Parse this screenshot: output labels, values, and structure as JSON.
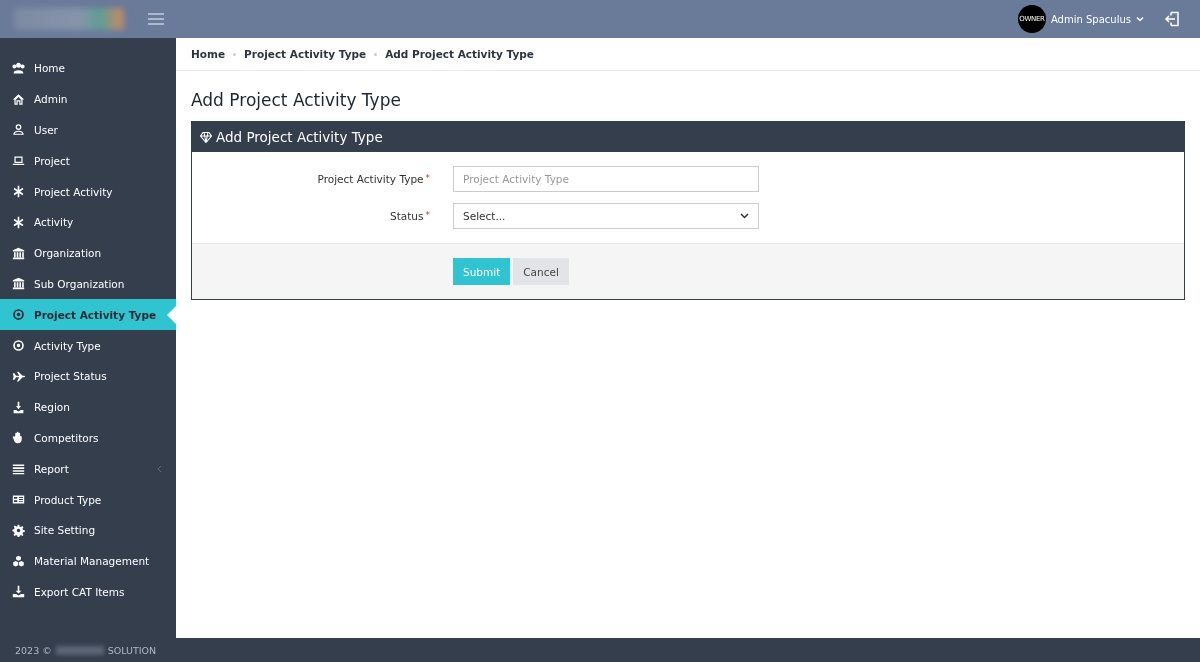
{
  "topbar": {
    "user": {
      "avatar_text": "OWNER",
      "name": "Admin Spaculus"
    }
  },
  "sidebar": {
    "items": [
      {
        "label": "Home",
        "selected": false,
        "expandable": false
      },
      {
        "label": "Admin",
        "selected": false,
        "expandable": false
      },
      {
        "label": "User",
        "selected": false,
        "expandable": false
      },
      {
        "label": "Project",
        "selected": false,
        "expandable": false
      },
      {
        "label": "Project Activity",
        "selected": false,
        "expandable": false
      },
      {
        "label": "Activity",
        "selected": false,
        "expandable": false
      },
      {
        "label": "Organization",
        "selected": false,
        "expandable": false
      },
      {
        "label": "Sub Organization",
        "selected": false,
        "expandable": false
      },
      {
        "label": "Project Activity Type",
        "selected": true,
        "expandable": false
      },
      {
        "label": "Activity Type",
        "selected": false,
        "expandable": false
      },
      {
        "label": "Project Status",
        "selected": false,
        "expandable": false
      },
      {
        "label": "Region",
        "selected": false,
        "expandable": false
      },
      {
        "label": "Competitors",
        "selected": false,
        "expandable": false
      },
      {
        "label": "Report",
        "selected": false,
        "expandable": true
      },
      {
        "label": "Product Type",
        "selected": false,
        "expandable": false
      },
      {
        "label": "Site Setting",
        "selected": false,
        "expandable": false
      },
      {
        "label": "Material Management",
        "selected": false,
        "expandable": false
      },
      {
        "label": "Export CAT Items",
        "selected": false,
        "expandable": false
      }
    ]
  },
  "breadcrumb": [
    "Home",
    "Project Activity Type",
    "Add Project Activity Type"
  ],
  "page_title": "Add Project Activity Type",
  "panel": {
    "title": "Add Project Activity Type",
    "fields": [
      {
        "kind": "text",
        "label": "Project Activity Type",
        "required_mark": "*",
        "placeholder": "Project Activity Type"
      },
      {
        "kind": "select",
        "label": "Status",
        "required_mark": "*",
        "value": "Select..."
      }
    ],
    "buttons": [
      {
        "label": "Submit",
        "kind": "primary"
      },
      {
        "label": "Cancel",
        "kind": "secondary"
      }
    ]
  },
  "footer": {
    "year": "2023 ©",
    "company": "SOLUTION"
  }
}
